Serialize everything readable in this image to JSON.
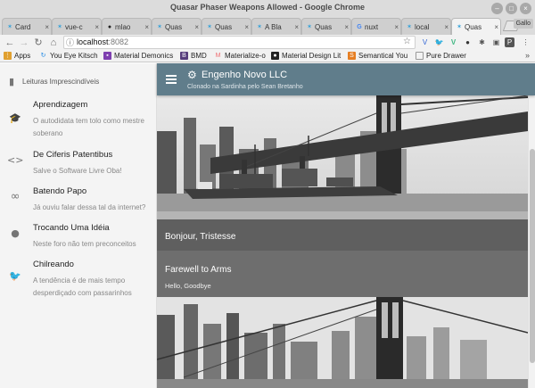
{
  "window": {
    "title": "Quasar Phaser Weapons Allowed - Google Chrome",
    "profile": "Gallo"
  },
  "tabs": [
    {
      "label": "Card",
      "icon": "quasar-icon",
      "active": false
    },
    {
      "label": "vue-c",
      "icon": "quasar-icon",
      "active": false
    },
    {
      "label": "mlao",
      "icon": "github-icon",
      "active": false
    },
    {
      "label": "Quas",
      "icon": "quasar-icon",
      "active": false
    },
    {
      "label": "Quas",
      "icon": "quasar-icon",
      "active": false
    },
    {
      "label": "A Bla",
      "icon": "quasar-icon",
      "active": false
    },
    {
      "label": "Quas",
      "icon": "quasar-icon",
      "active": false
    },
    {
      "label": "nuxt",
      "icon": "google-icon",
      "active": false
    },
    {
      "label": "local",
      "icon": "quasar-icon",
      "active": false
    },
    {
      "label": "Quas",
      "icon": "quasar-icon",
      "active": true
    }
  ],
  "addressbar": {
    "host": "localhost",
    "port": ":8082"
  },
  "bookmarks": [
    {
      "label": "Apps",
      "icon": "apps-icon",
      "color": "#e0a030"
    },
    {
      "label": "You Eye Kitsch",
      "icon": "refresh-icon",
      "color": "#1e88e5"
    },
    {
      "label": "Material Demonics",
      "icon": "material-icon",
      "color": "#7e3fb0"
    },
    {
      "label": "BMD",
      "icon": "bootstrap-icon",
      "color": "#563d7c"
    },
    {
      "label": "Materialize-o",
      "icon": "materialize-icon",
      "color": "#ee6e73"
    },
    {
      "label": "Material Design Lit",
      "icon": "github-icon",
      "color": "#222222"
    },
    {
      "label": "Semantical You",
      "icon": "semantic-icon",
      "color": "#e67e22"
    },
    {
      "label": "Pure Drawer",
      "icon": "page-icon",
      "color": "#ffffff"
    }
  ],
  "appbar": {
    "title": "Engenho Novo LLC",
    "subtitle": "Clonado na Sardinha pelo Sean Bretanho",
    "color": "#607d8b"
  },
  "drawer": {
    "header": "Leituras Imprescindíveis",
    "items": [
      {
        "title": "Aprendizagem",
        "subtitle": "O autodidata tem tolo como mestre soberano",
        "icon": "school-icon"
      },
      {
        "title": "De Ciferis Patentibus",
        "subtitle": "Salve o Software Livre Oba!",
        "icon": "code-icon"
      },
      {
        "title": "Batendo Papo",
        "subtitle": "Já ouviu falar dessa tal da internet?",
        "icon": "infinity-icon"
      },
      {
        "title": "Trocando Uma Idéia",
        "subtitle": "Neste foro não tem preconceitos",
        "icon": "record-voice-icon"
      },
      {
        "title": "Chilreando",
        "subtitle": "A tendência é de mais tempo desperdiçado com passarinhos",
        "icon": "twitter-icon"
      }
    ]
  },
  "cards": [
    {
      "title": "Bonjour, Tristesse",
      "subtitle": ""
    },
    {
      "title": "Farewell to Arms",
      "subtitle": "Hello, Goodbye"
    }
  ]
}
